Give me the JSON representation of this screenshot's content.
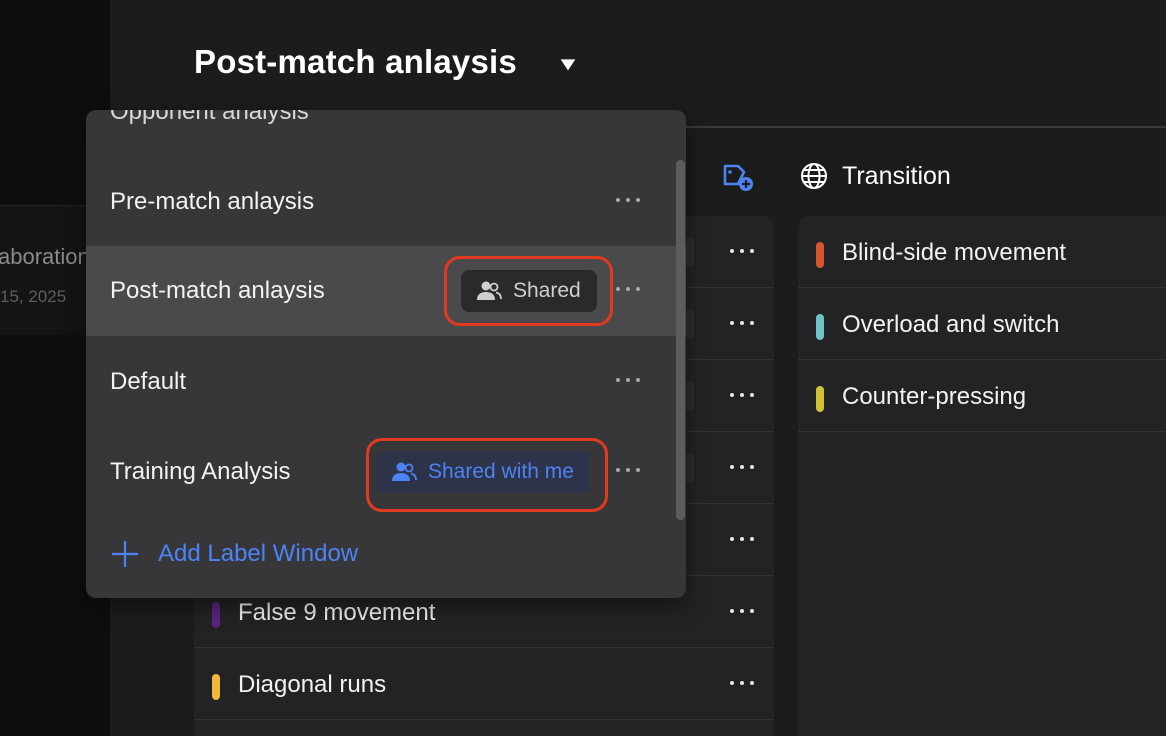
{
  "left_panel": {
    "card_title": "aboration",
    "card_date": "15, 2025"
  },
  "header": {
    "title": "Post-match anlaysis"
  },
  "column_left": {
    "rows": [
      {
        "label": "",
        "color": "#6b6b6b"
      },
      {
        "label": "",
        "color": "#6b6b6b"
      },
      {
        "label": "",
        "color": "#6b6b6b"
      },
      {
        "label": "",
        "color": "#6b6b6b"
      },
      {
        "label": "",
        "color": "#6b6b6b"
      },
      {
        "label": "False 9 movement",
        "color": "#5b2580"
      },
      {
        "label": "Diagonal runs",
        "color": "#f4b73d"
      }
    ]
  },
  "column_right": {
    "title": "Transition",
    "icon": "globe-icon",
    "rows": [
      {
        "label": "Blind-side movement",
        "color": "#d4572e"
      },
      {
        "label": "Overload and switch",
        "color": "#6fc3c7"
      },
      {
        "label": "Counter-pressing",
        "color": "#cfc235"
      }
    ]
  },
  "dropdown": {
    "partial_item": "Opponent analysis",
    "items": [
      {
        "label": "Pre-match anlaysis",
        "badge": ""
      },
      {
        "label": "Post-match anlaysis",
        "badge": "Shared",
        "active": true
      },
      {
        "label": "Default",
        "badge": ""
      },
      {
        "label": "Training Analysis",
        "badge": "Shared with me"
      }
    ],
    "add_label": "Add Label Window"
  },
  "colors": {
    "accent_blue": "#4d83f5",
    "annotation_red": "#e23a1e",
    "dropdown_bg": "#373739",
    "active_bg": "#4a4a4c"
  }
}
